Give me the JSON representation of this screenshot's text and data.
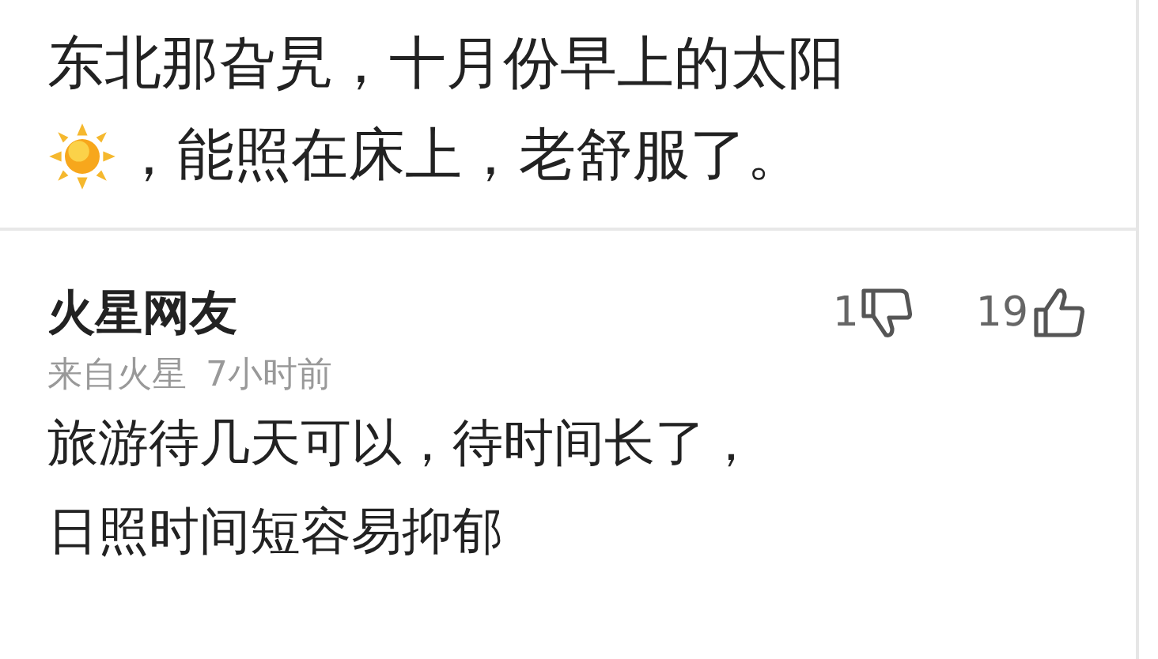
{
  "previous_comment": {
    "line_1": "东北那旮旯，十月份早上的太阳",
    "line_2": "，能照在床上，老舒服了。"
  },
  "comment": {
    "username": "火星网友",
    "location": "来自火星",
    "time": "7小时前",
    "dislikes": "1",
    "likes": "19",
    "lines": [
      "旅游待几天可以，待时间长了，",
      "日照时间短容易抑郁"
    ]
  }
}
